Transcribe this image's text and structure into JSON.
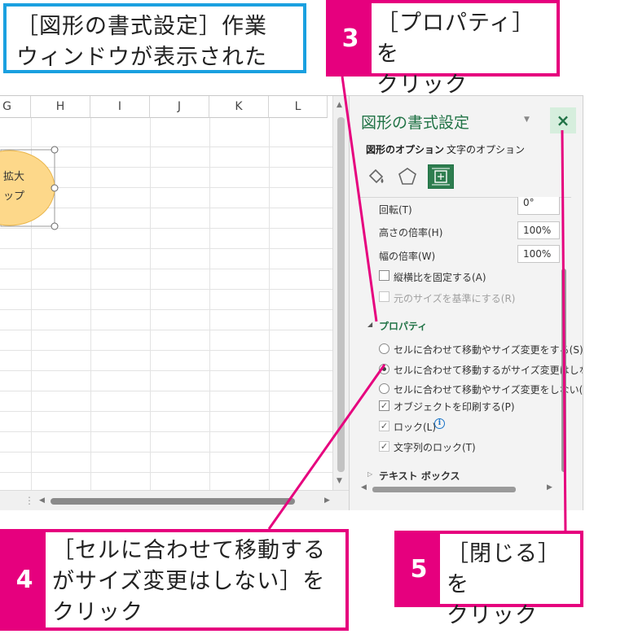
{
  "callouts": {
    "title": {
      "line1": "［図形の書式設定］作業",
      "line2": "ウィンドウが表示された"
    },
    "step3": {
      "num": "3",
      "line1": "［プロパティ］を",
      "line2": "クリック"
    },
    "step4": {
      "num": "4",
      "line1": "［セルに合わせて移動する",
      "line2": "がサイズ変更はしない］を",
      "line3": "クリック"
    },
    "step5": {
      "num": "5",
      "line1": "［閉じる］を",
      "line2": "クリック"
    }
  },
  "sheet": {
    "columns": [
      "G",
      "H",
      "I",
      "J",
      "K",
      "L"
    ],
    "shape_text": {
      "line1": "拡大",
      "line2": "ップ"
    }
  },
  "pane": {
    "title": "図形の書式設定",
    "close_icon": "×",
    "dropdown_icon": "▼",
    "tabs": {
      "shape_options": "図形のオプション",
      "text_options": "文字のオプション"
    },
    "fields": [
      {
        "label": "回転(T)",
        "value": "0°"
      },
      {
        "label": "高さの倍率(H)",
        "value": "100%"
      },
      {
        "label": "幅の倍率(W)",
        "value": "100%"
      }
    ],
    "lock_aspect": "縦横比を固定する(A)",
    "relative_original": "元のサイズを基準にする(R)",
    "properties_heading": "プロパティ",
    "radio_options": [
      "セルに合わせて移動やサイズ変更をする(S)",
      "セルに合わせて移動するがサイズ変更はしない",
      "セルに合わせて移動やサイズ変更をしない("
    ],
    "print_object": "オブジェクトを印刷する(P)",
    "lock": "ロック(L)",
    "lock_text": "文字列のロック(T)",
    "textbox_heading": "テキスト ボックス",
    "info_icon": "i"
  },
  "colors": {
    "accent_pink": "#e6007e",
    "accent_blue": "#1aa0e0",
    "excel_green": "#217346"
  }
}
